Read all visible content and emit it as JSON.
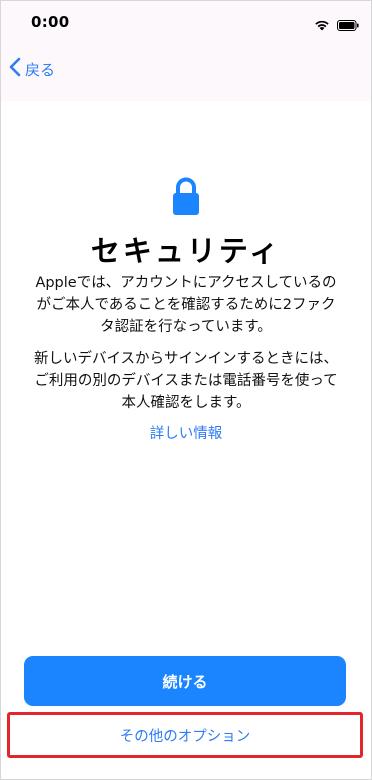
{
  "status_bar": {
    "time": "0:00"
  },
  "nav": {
    "back_label": "戻る"
  },
  "content": {
    "title": "セキュリティ",
    "paragraph1": "Appleでは、アカウントにアクセスしているのがご本人であることを確認するために2ファクタ認証を行なっています。",
    "paragraph2": "新しいデバイスからサインインするときには、ご利用の別のデバイスまたは電話番号を使って本人確認をします。",
    "learn_more_link": "詳しい情報"
  },
  "actions": {
    "continue_label": "続ける",
    "other_options_label": "その他のオプション"
  },
  "icons": {
    "lock": "lock-icon",
    "back": "chevron-left-icon",
    "wifi": "wifi-icon",
    "battery": "battery-icon"
  },
  "colors": {
    "accent": "#2e7cf6",
    "button_fill": "#1a85ff",
    "highlight": "#e3262b",
    "nav_background": "#fdf8fb"
  }
}
